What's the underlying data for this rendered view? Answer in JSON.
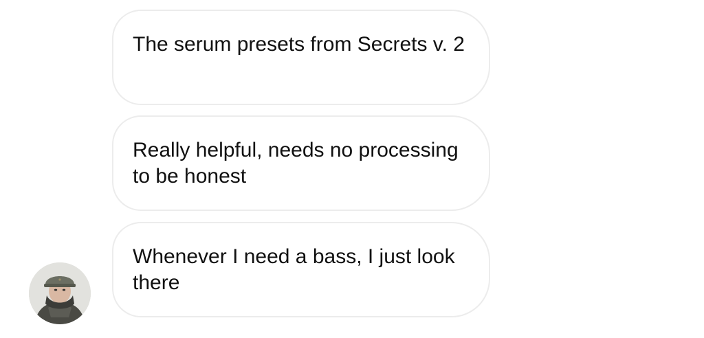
{
  "conversation": {
    "messages": [
      {
        "text": "The serum presets from Secrets v. 2"
      },
      {
        "text": "Really helpful, needs no processing to be honest"
      },
      {
        "text": "Whenever I need a bass, I just look there"
      }
    ],
    "sender_avatar": {
      "icon": "user-photo-avatar"
    }
  },
  "colors": {
    "bubble_border": "#ececec",
    "bubble_background": "#ffffff",
    "text": "#111111",
    "page_background": "#ffffff"
  }
}
